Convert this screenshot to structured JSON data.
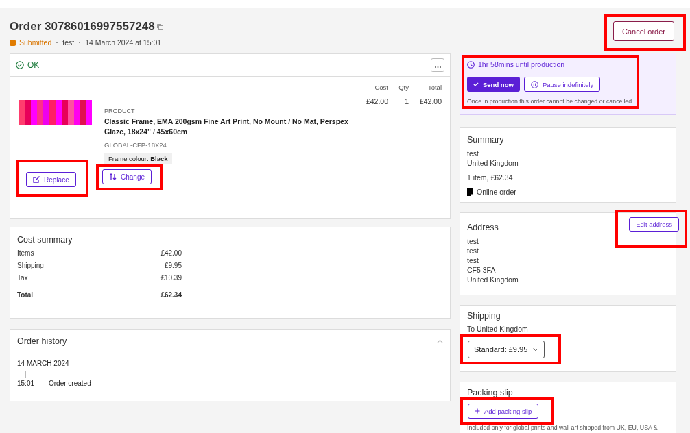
{
  "order": {
    "title": "Order 30786016997557248",
    "status": "Submitted",
    "customer": "test",
    "date": "14 March 2024 at 15:01"
  },
  "cancel_button": {
    "label": "Cancel order",
    "highlighted": true
  },
  "item_card": {
    "status": "OK",
    "columns": [
      "Cost",
      "Qty",
      "Total"
    ],
    "product": {
      "type_label": "PRODUCT",
      "name": "Classic Frame, EMA 200gsm Fine Art Print, No Mount / No Mat, Perspex Glaze, 18x24\" / 45x60cm",
      "sku": "GLOBAL-CFP-18X24",
      "attribute": "Frame colour: **Black**",
      "cost": "£42.00",
      "qty": "1",
      "total": "£42.00"
    },
    "actions": [
      {
        "label": "Replace",
        "highlighted": true
      },
      {
        "label": "Change",
        "highlighted": true
      }
    ]
  },
  "cost_summary": {
    "title": "Cost summary",
    "rows": [
      {
        "label": "Items",
        "value": "£42.00",
        "bold": false
      },
      {
        "label": "Shipping",
        "value": "£9.95",
        "bold": false
      },
      {
        "label": "Tax",
        "value": "£10.39",
        "bold": false
      },
      {
        "label": "Total",
        "value": "£62.34",
        "bold": true
      }
    ]
  },
  "order_history": {
    "title": "Order history",
    "expanded": true,
    "date": "14 MARCH 2024",
    "events": [
      {
        "time": "15:01",
        "text": "Order created"
      }
    ]
  },
  "production": {
    "countdown": "1hr 58mins until production",
    "highlighted": true,
    "buttons": [
      {
        "label": "Send now",
        "kind": "primary"
      },
      {
        "label": "Pause indefinitely",
        "kind": "secondary"
      }
    ],
    "note": "Once in production this order cannot be changed or cancelled."
  },
  "summary": {
    "title": "Summary",
    "lines": [
      "test",
      "United Kingdom"
    ],
    "items": "1 item, £62.34",
    "source": "Online order"
  },
  "address": {
    "title": "Address",
    "button": {
      "label": "Edit address",
      "highlighted": true
    },
    "lines": [
      "test",
      "test",
      "test",
      "CF5 3FA",
      "United Kingdom"
    ]
  },
  "shipping": {
    "title": "Shipping",
    "destination": "To United Kingdom",
    "method": {
      "value": "Standard: £9.95",
      "highlighted": true
    }
  },
  "packing_slip": {
    "title": "Packing slip",
    "button": {
      "label": "Add packing slip",
      "highlighted": true
    },
    "note": "Included only for global prints and wall art shipped from UK, EU, USA &"
  }
}
